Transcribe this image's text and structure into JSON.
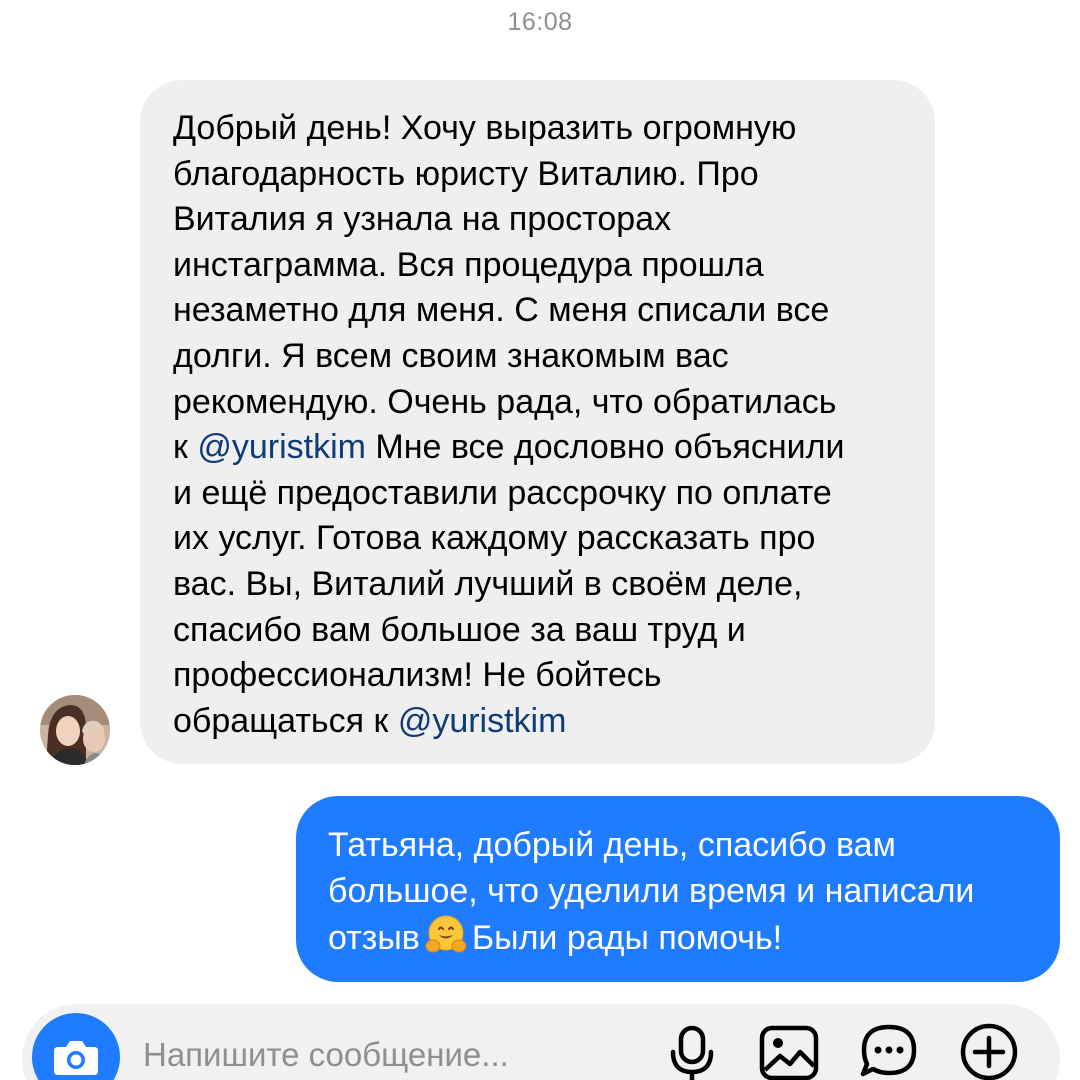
{
  "header": {
    "timestamp": "16:08"
  },
  "messages": {
    "incoming": {
      "lines": [
        {
          "text": "Добрый день! Хочу выразить огромную"
        },
        {
          "text": "благодарность юристу Виталию. Про"
        },
        {
          "text": "Виталия я узнала на просторах"
        },
        {
          "text": "инстаграмма. Вся процедура прошла"
        },
        {
          "text": "незаметно для меня. С меня списали все"
        },
        {
          "text": "долги. Я всем своим знакомым вас"
        },
        {
          "text": "рекомендую. Очень рада, что обратилась"
        },
        {
          "pre": "к ",
          "mention": "@yuristkim",
          "post": " Мне все дословно объяснили"
        },
        {
          "text": "и ещё предоставили рассрочку по оплате"
        },
        {
          "text": "их услуг. Готова каждому рассказать про"
        },
        {
          "text": "вас. Вы, Виталий  лучший в своём деле,"
        },
        {
          "text": "спасибо вам большое за ваш труд и"
        },
        {
          "text": "профессионализм! Не бойтесь"
        },
        {
          "pre": "обращаться к ",
          "mention": "@yuristkim",
          "post": ""
        }
      ],
      "bubble_color": "#efefef",
      "mention_color": "#0f3b78"
    },
    "outgoing": {
      "lines": [
        {
          "text": "Татьяна, добрый день, спасибо вам"
        },
        {
          "text": "большое, что уделили время и написали"
        },
        {
          "pre": "отзыв",
          "emoji": "hugging-face-emoji",
          "post": "Были рады помочь!"
        }
      ],
      "bubble_color": "#1f7bff"
    }
  },
  "composer": {
    "placeholder": "Напишите сообщение...",
    "camera_icon": "camera-icon",
    "mic_icon": "microphone-icon",
    "gallery_icon": "image-gallery-icon",
    "sticker_icon": "chat-bubble-icon",
    "add_icon": "plus-circle-icon",
    "accent_color": "#1f7bff"
  }
}
